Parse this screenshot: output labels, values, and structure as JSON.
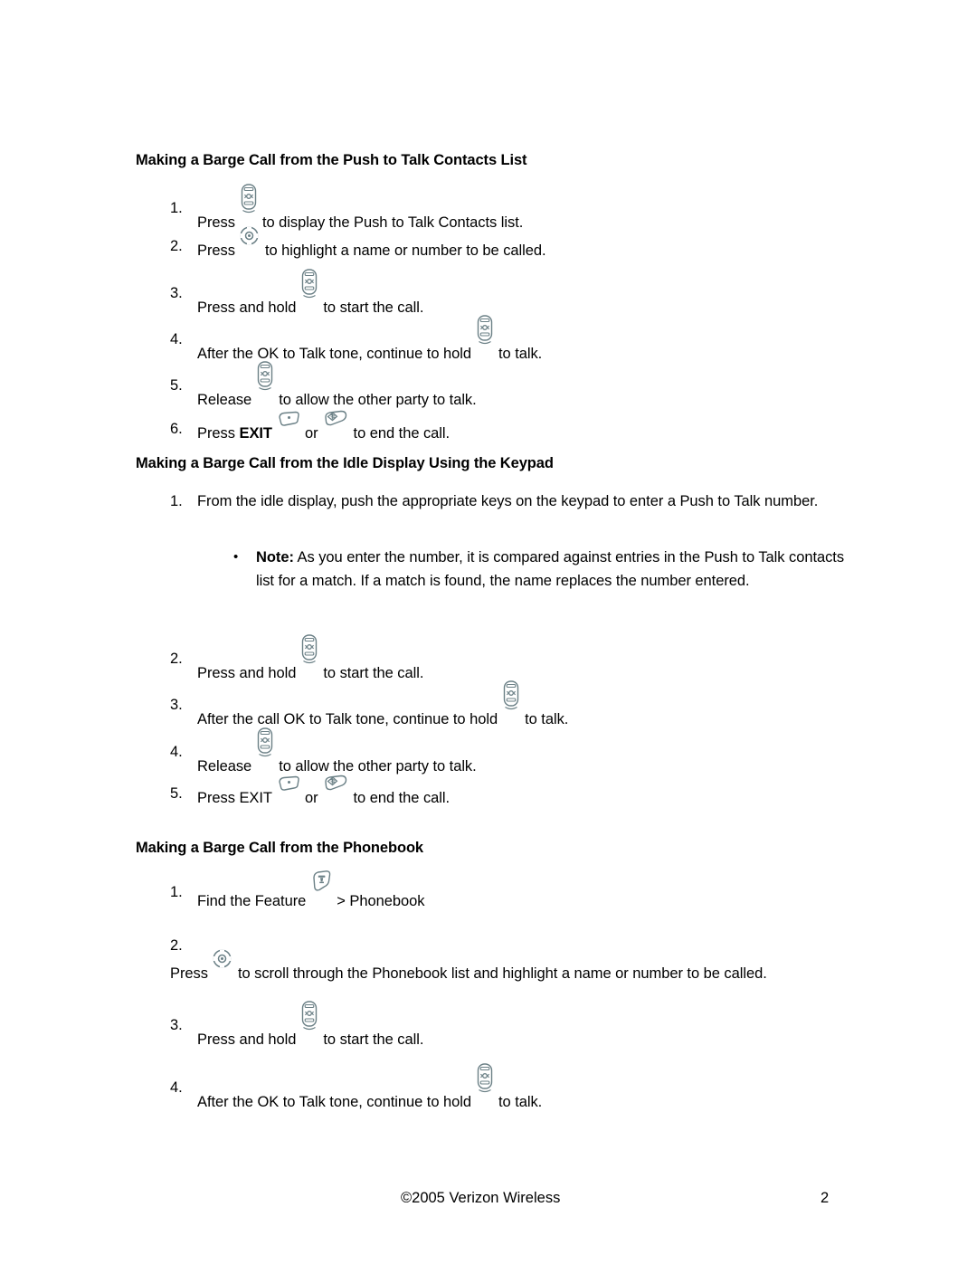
{
  "document": {
    "sections": [
      {
        "heading": "Making a Barge Call from the Push to Talk Contacts List",
        "steps": [
          {
            "num": "1.",
            "pre": "Press",
            "icon": "ptt-key-icon",
            "post": "to display the Push to Talk Contacts list."
          },
          {
            "num": "2.",
            "pre": "Press",
            "icon": "navigation-key-icon",
            "post": "to highlight a name or number to be called."
          },
          {
            "num": "3.",
            "pre": "Press and hold",
            "icon": "ptt-key-icon",
            "post": "to start the call."
          },
          {
            "num": "4.",
            "pre": "After the OK to Talk tone, continue to hold",
            "icon": "ptt-key-icon",
            "post": "to talk."
          },
          {
            "num": "5.",
            "pre": "Release",
            "icon": "ptt-key-icon",
            "post": "to allow the other party to talk."
          },
          {
            "num": "6.",
            "pre": "Press",
            "bold_label": "EXIT",
            "icon": "exit-softkey-icon",
            "mid": "or",
            "icon2": "end-call-key-icon",
            "post": "to end the call."
          }
        ]
      },
      {
        "heading": "Making a Barge Call from the Idle Display Using the Keypad",
        "steps": [
          {
            "num": "1.",
            "pre": "From the idle display, push the appropriate keys on the keypad to enter a Push to Talk number."
          },
          {
            "num": "2.",
            "pre": "Press and hold",
            "icon": "ptt-key-icon",
            "post": "to start the call."
          },
          {
            "num": "3.",
            "pre": "After the call OK to Talk tone, continue to hold",
            "icon": "ptt-key-icon",
            "post": "to talk."
          },
          {
            "num": "4.",
            "pre": "Release",
            "icon": "ptt-key-icon",
            "post": "to allow the other party to talk."
          },
          {
            "num": "5.",
            "pre": "Press EXIT",
            "icon": "exit-softkey-icon",
            "mid": "or",
            "icon2": "end-call-key-icon",
            "post": "to end the call."
          }
        ],
        "note": {
          "bullet": "•",
          "label": "Note:",
          "text": " As you enter the number, it is compared against entries in the Push to Talk contacts list for a match. If a match is found, the name replaces the number entered."
        }
      },
      {
        "heading": "Making a Barge Call from the Phonebook",
        "steps": [
          {
            "num": "1.",
            "pre": "Find the Feature",
            "icon": "menu-softkey-icon",
            "post": "> Phonebook"
          },
          {
            "num": "2.",
            "pre": "Press",
            "icon": "navigation-key-icon",
            "post": "to scroll through the Phonebook list and highlight a name or number to be called."
          },
          {
            "num": "3.",
            "pre": "Press and hold",
            "icon": "ptt-key-icon",
            "post": "to start the call."
          },
          {
            "num": "4.",
            "pre": "After the OK to Talk tone, continue to hold",
            "icon": "ptt-key-icon",
            "post": "to talk."
          }
        ]
      }
    ]
  },
  "footer": {
    "copyright": "©2005 Verizon Wireless",
    "page_number": "2"
  },
  "colors": {
    "text": "#000000",
    "icon_outline": "#6b8086",
    "page_background": "#ffffff"
  }
}
